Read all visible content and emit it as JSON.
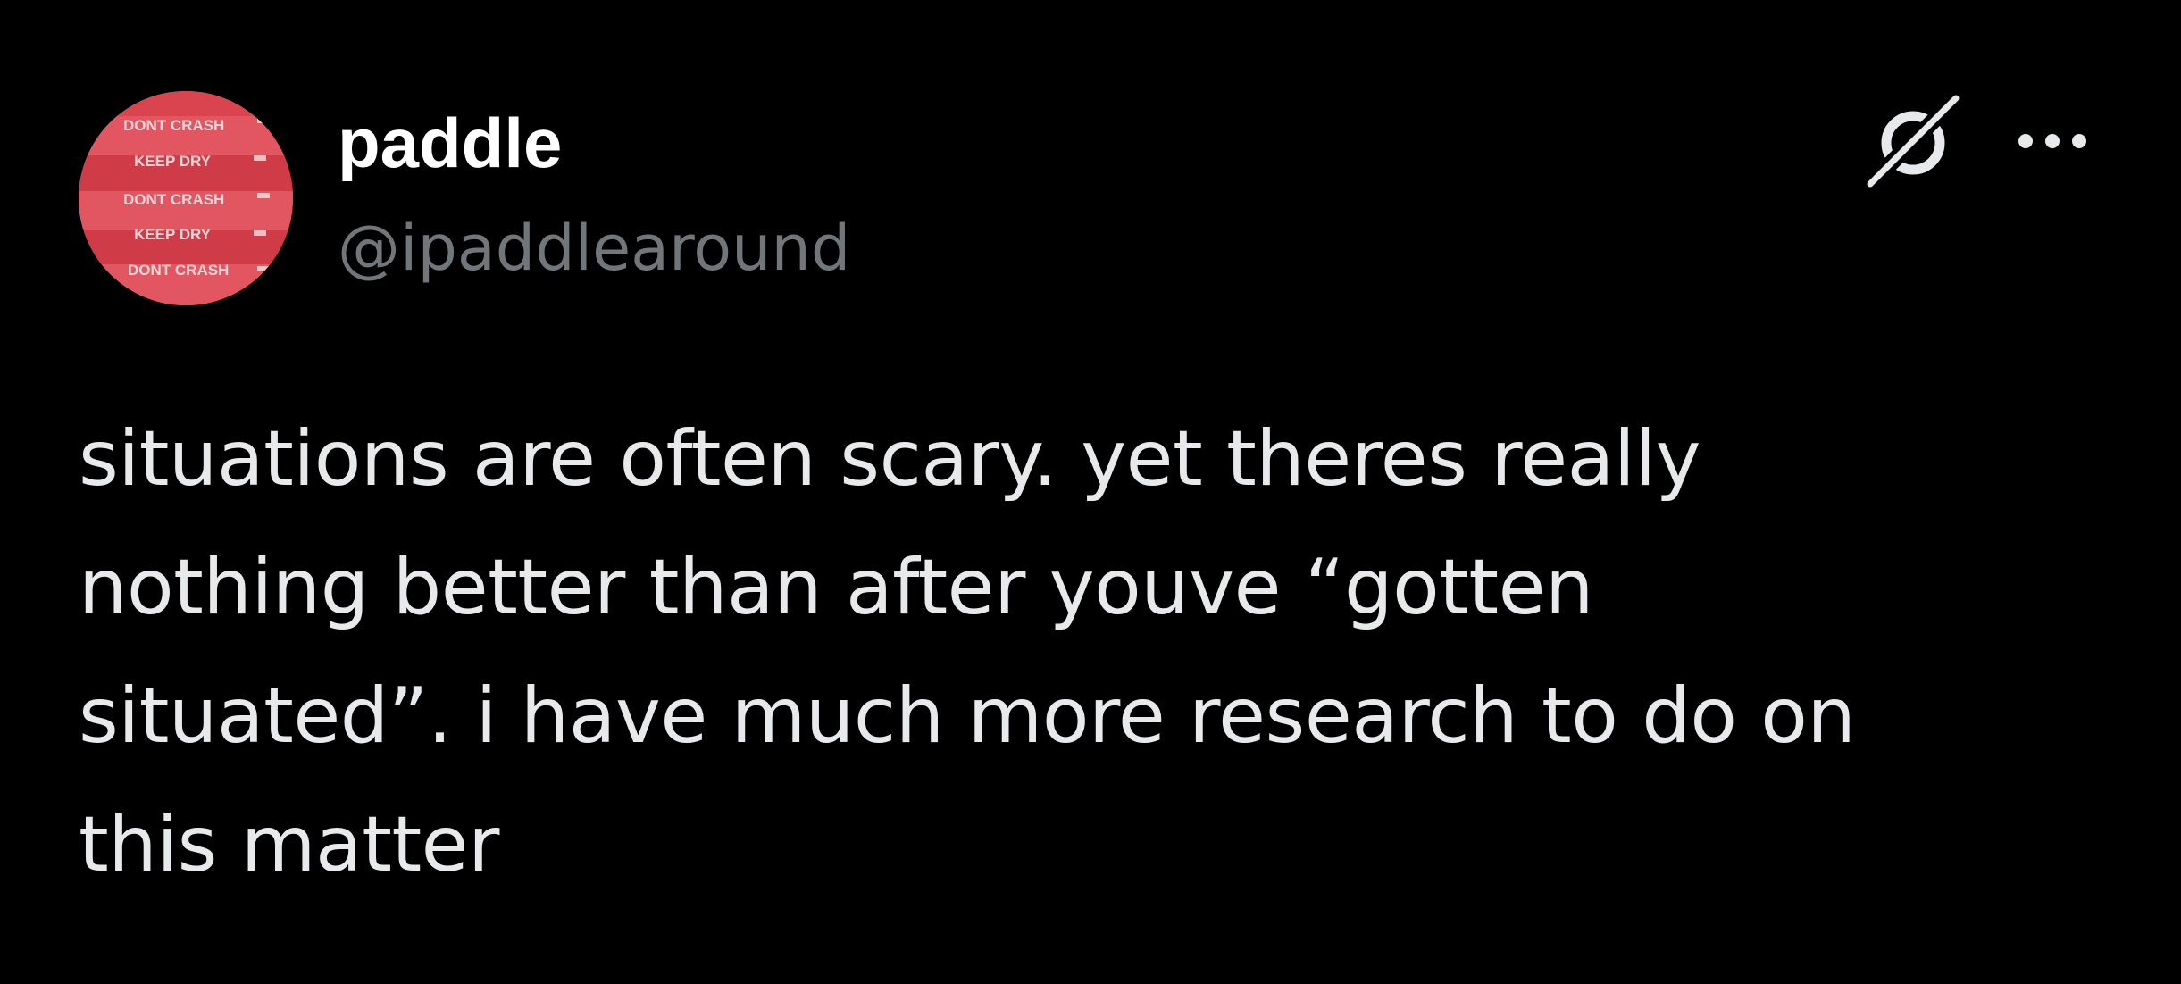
{
  "colors": {
    "background": "#000000",
    "name": "#ffffff",
    "handle": "#71767b",
    "text": "#e7e9ea",
    "avatar_bg": "#d9444f"
  },
  "author": {
    "display_name": "paddle",
    "handle": "@ipaddlearound",
    "avatar": {
      "icon": "avatar-image",
      "label_lines": [
        "DONT CRASH",
        "KEEP DRY",
        "DONT CRASH",
        "KEEP DRY",
        "DONT CRASH"
      ]
    }
  },
  "actions": {
    "grok_icon": "grok-icon",
    "more_icon": "more-options-icon"
  },
  "tweet": {
    "lines": [
      "situations are often scary. yet theres really",
      "nothing better than after youve “gotten",
      "situated”. i have much more research to do on",
      "this matter"
    ]
  }
}
